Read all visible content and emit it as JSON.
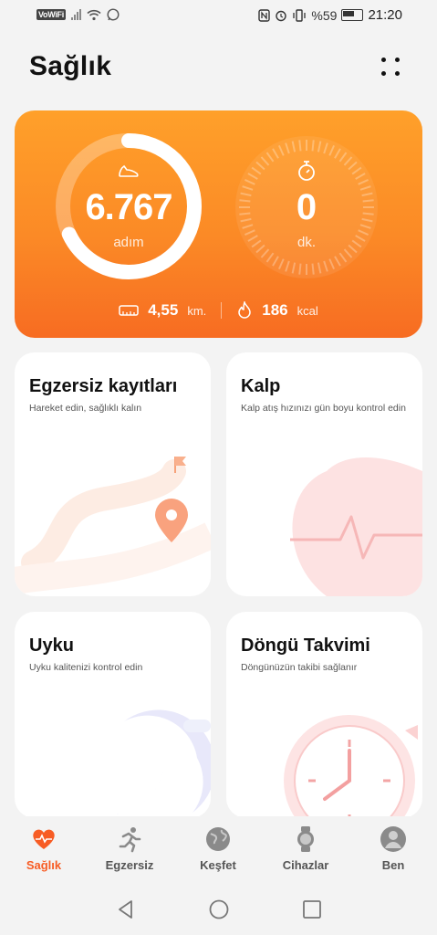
{
  "status_bar": {
    "volte": "VoWiFi",
    "battery": "%59",
    "time": "21:20"
  },
  "header": {
    "title": "Sağlık"
  },
  "summary": {
    "steps_value": "6.767",
    "steps_unit": "adım",
    "steps_progress": 0.68,
    "minutes_value": "0",
    "minutes_unit": "dk.",
    "distance_value": "4,55",
    "distance_unit": "km.",
    "calories_value": "186",
    "calories_unit": "kcal"
  },
  "tiles": [
    {
      "title": "Egzersiz kayıtları",
      "subtitle": "Hareket edin, sağlıklı kalın"
    },
    {
      "title": "Kalp",
      "subtitle": "Kalp atış hızınızı gün boyu kontrol edin"
    },
    {
      "title": "Uyku",
      "subtitle": "Uyku kalitenizi kontrol edin"
    },
    {
      "title": "Döngü Takvimi",
      "subtitle": "Döngünüzün takibi sağlanır"
    }
  ],
  "bottom_nav": [
    {
      "label": "Sağlık",
      "icon": "heart-pulse-icon",
      "active": true
    },
    {
      "label": "Egzersiz",
      "icon": "runner-icon",
      "active": false
    },
    {
      "label": "Keşfet",
      "icon": "globe-icon",
      "active": false
    },
    {
      "label": "Cihazlar",
      "icon": "watch-icon",
      "active": false
    },
    {
      "label": "Ben",
      "icon": "profile-icon",
      "active": false
    }
  ],
  "colors": {
    "accent": "#f75c24",
    "card_gradient_top": "#ffa02a",
    "card_gradient_bottom": "#f76c22"
  }
}
